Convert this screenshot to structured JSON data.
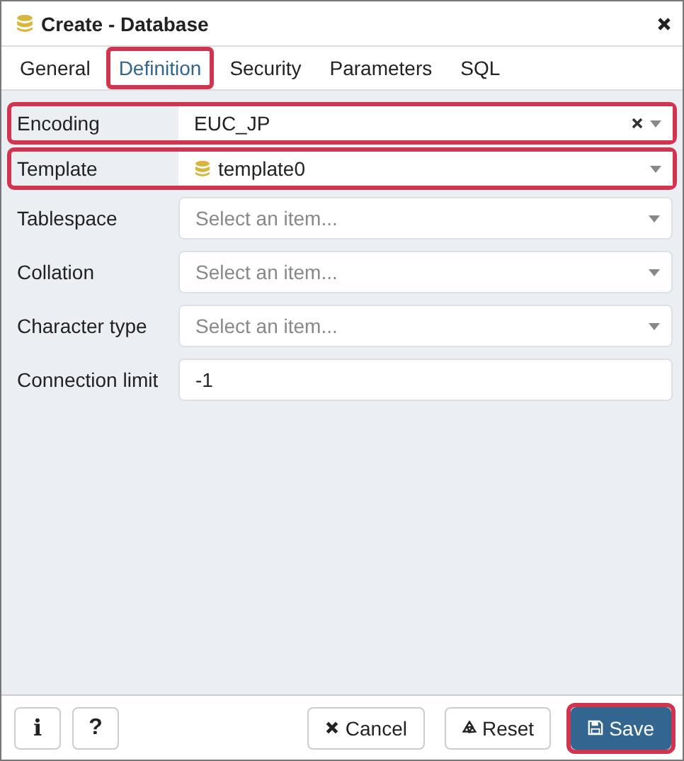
{
  "window": {
    "title": "Create - Database"
  },
  "tabs": [
    {
      "label": "General",
      "selected": false,
      "highlighted": false
    },
    {
      "label": "Definition",
      "selected": true,
      "highlighted": true
    },
    {
      "label": "Security",
      "selected": false,
      "highlighted": false
    },
    {
      "label": "Parameters",
      "selected": false,
      "highlighted": false
    },
    {
      "label": "SQL",
      "selected": false,
      "highlighted": false
    }
  ],
  "fields": [
    {
      "label": "Encoding",
      "kind": "select",
      "value": "EUC_JP",
      "clearable": true,
      "db_icon": false,
      "highlighted": true
    },
    {
      "label": "Template",
      "kind": "select",
      "value": "template0",
      "clearable": false,
      "db_icon": true,
      "highlighted": true
    },
    {
      "label": "Tablespace",
      "kind": "select",
      "placeholder": "Select an item...",
      "clearable": false,
      "db_icon": false,
      "highlighted": false
    },
    {
      "label": "Collation",
      "kind": "select",
      "placeholder": "Select an item...",
      "clearable": false,
      "db_icon": false,
      "highlighted": false
    },
    {
      "label": "Character type",
      "kind": "select",
      "placeholder": "Select an item...",
      "clearable": false,
      "db_icon": false,
      "highlighted": false
    },
    {
      "label": "Connection limit",
      "kind": "text",
      "value": "-1",
      "clearable": false,
      "db_icon": false,
      "highlighted": false
    }
  ],
  "footer": {
    "info": "i",
    "help": "?",
    "buttons": [
      {
        "label": "Cancel",
        "kind": "cancel",
        "highlighted": false
      },
      {
        "label": "Reset",
        "kind": "reset",
        "highlighted": false
      },
      {
        "label": "Save",
        "kind": "save",
        "highlighted": true
      }
    ]
  }
}
